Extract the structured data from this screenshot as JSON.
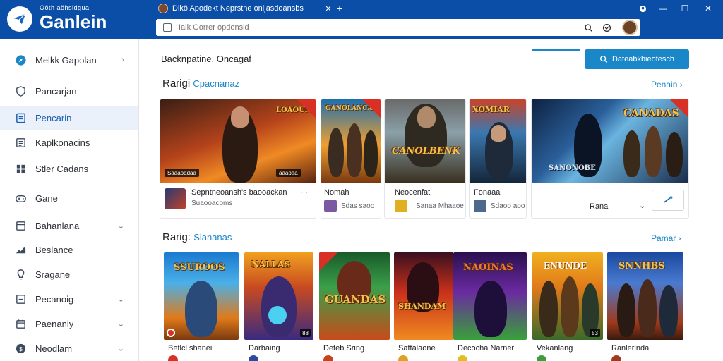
{
  "app": {
    "brand_small": "Oöth aöhsidgua",
    "brand_title": "Ganlein",
    "tab_title": "Dlkö Apodekt Neprstne onljasdoansbs",
    "address_placeholder": "Ialk Gorrer opdonsid"
  },
  "sidebar": {
    "items": [
      {
        "label": "Melkk Gapolan",
        "icon": "compass-icon",
        "chevron": "›"
      },
      {
        "label": "Pancarjan",
        "icon": "shield-icon"
      },
      {
        "label": "Pencarin",
        "icon": "document-icon",
        "active": true
      },
      {
        "label": "Kaplkonacins",
        "icon": "list-icon"
      },
      {
        "label": "Stler Cadans",
        "icon": "grid-icon"
      },
      {
        "label": "Gane",
        "icon": "controller-icon"
      },
      {
        "label": "Bahanlana",
        "icon": "folder-icon",
        "chevron": "⌄"
      },
      {
        "label": "Beslance",
        "icon": "chart-icon"
      },
      {
        "label": "Sragane",
        "icon": "bulb-icon"
      },
      {
        "label": "Pecanoig",
        "icon": "box-icon",
        "chevron": "⌄"
      },
      {
        "label": "Paenaniy",
        "icon": "calendar-icon",
        "chevron": "⌄"
      },
      {
        "label": "Neodlam",
        "icon": "coin-icon",
        "chevron": "⌄"
      }
    ]
  },
  "main": {
    "breadcrumb": "Backnpatine, Oncagaf",
    "download_button": "Dateabkbieotesch",
    "section1": {
      "title": "Rarigi",
      "title_accent": "Cpacnanaz",
      "more": "Penain ›",
      "cards": [
        {
          "title": "Sepntneoansh's baooackan",
          "subtitle": "Suaooacoms",
          "badge_left": "Saaaoadaa",
          "badge_right": "aaaoaa"
        },
        {
          "title": "Nomah",
          "subtitle": "Sdas saoo"
        },
        {
          "title": "Neocenfat",
          "subtitle": "Sanaa Mhaaoe"
        },
        {
          "title": "Fonaaa",
          "subtitle": "Sdaoo aoo"
        },
        {
          "title": "Rana"
        }
      ],
      "art_titles": [
        "LOAOUNAS",
        "GANOLANCA",
        "CANOLBENK",
        "XOMIAR",
        "CANADAS",
        "SANONOBE"
      ]
    },
    "section2": {
      "title": "Rarig:",
      "title_accent": "Slananas",
      "more": "Pamar ›",
      "cards": [
        {
          "title": "Betlcl shanei",
          "art": "SSUROOS"
        },
        {
          "title": "Darbaing",
          "art": "NALLAS"
        },
        {
          "title": "Deteb Sring",
          "art": "GUANDAS"
        },
        {
          "title": "Sattalaone",
          "art": "SHANDAM"
        },
        {
          "title": "Decocha Narner",
          "art": "NAOINAS"
        },
        {
          "title": "Vekanlang",
          "art": "ENUNDE"
        },
        {
          "title": "Ranlerlnda",
          "art": "SNNHBS"
        }
      ],
      "corner_values": [
        "88",
        "53"
      ]
    }
  }
}
